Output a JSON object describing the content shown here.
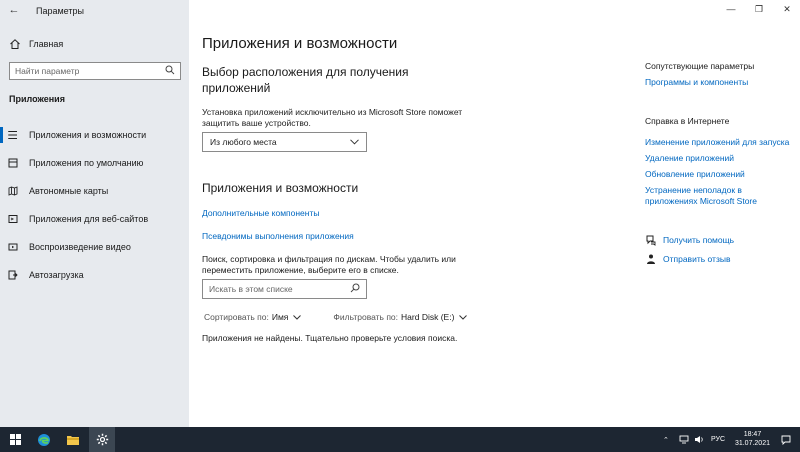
{
  "window": {
    "title": "Параметры",
    "controls": {
      "minimize": "—",
      "maximize": "❐",
      "close": "✕"
    }
  },
  "sidebar": {
    "home_label": "Главная",
    "search_placeholder": "Найти параметр",
    "section_label": "Приложения",
    "items": [
      {
        "label": "Приложения и возможности",
        "icon": "apps-list-icon",
        "active": true
      },
      {
        "label": "Приложения по умолчанию",
        "icon": "default-apps-icon"
      },
      {
        "label": "Автономные карты",
        "icon": "map-icon"
      },
      {
        "label": "Приложения для веб-сайтов",
        "icon": "web-apps-icon"
      },
      {
        "label": "Воспроизведение видео",
        "icon": "video-icon"
      },
      {
        "label": "Автозагрузка",
        "icon": "startup-icon"
      }
    ]
  },
  "main": {
    "title": "Приложения и возможности",
    "install_section_title": "Выбор расположения для получения приложений",
    "install_description": "Установка приложений исключительно из Microsoft Store поможет защитить ваше устройство.",
    "install_source_selected": "Из любого места",
    "apps_section_title": "Приложения и возможности",
    "link_optional_features": "Дополнительные компоненты",
    "link_app_aliases": "Псевдонимы выполнения приложения",
    "search_description": "Поиск, сортировка и фильтрация по дискам. Чтобы удалить или переместить приложение, выберите его в списке.",
    "search_placeholder": "Искать в этом списке",
    "sort_label": "Сортировать по:",
    "sort_value": "Имя",
    "filter_label": "Фильтровать по:",
    "filter_value": "Hard Disk (E:)",
    "empty_message": "Приложения не найдены. Тщательно проверьте условия поиска."
  },
  "right": {
    "related_title": "Сопутствующие параметры",
    "related_links": [
      "Программы и компоненты"
    ],
    "web_help_title": "Справка в Интернете",
    "web_help_links": [
      "Изменение приложений для запуска",
      "Удаление приложений",
      "Обновление приложений",
      "Устранение неполадок в приложениях Microsoft Store"
    ],
    "get_help": "Получить помощь",
    "send_feedback": "Отправить отзыв"
  },
  "taskbar": {
    "language": "РУС",
    "time": "18:47",
    "date": "31.07.2021"
  },
  "colors": {
    "accent": "#0067c0",
    "sidebar_bg": "#e7eaee",
    "taskbar_bg": "#1d2632"
  }
}
